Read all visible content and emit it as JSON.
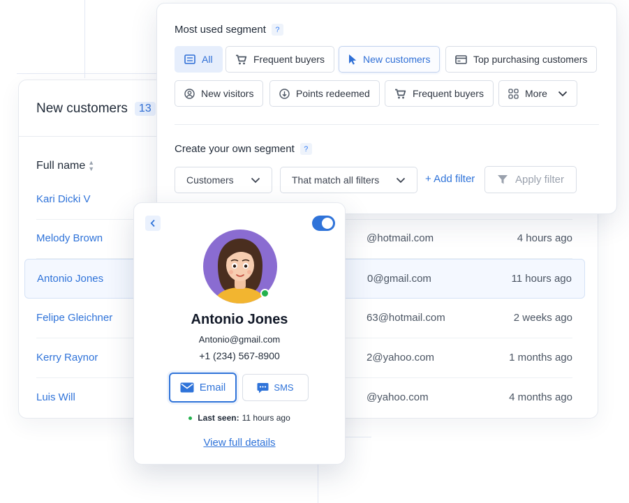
{
  "colors": {
    "accent": "#2f73d9",
    "online": "#22b14c",
    "chip_active_bg": "#e6eefc",
    "avatar_bg": "#8a6cd1"
  },
  "customers_table": {
    "title": "New customers",
    "count": "13",
    "column_full_name": "Full name",
    "rows": [
      {
        "name": "Kari Dicki V",
        "email": "",
        "last_seen": ""
      },
      {
        "name": "Melody Brown",
        "email": "@hotmail.com",
        "last_seen": "4 hours ago"
      },
      {
        "name": "Antonio Jones",
        "email": "0@gmail.com",
        "last_seen": "11 hours ago",
        "selected": true
      },
      {
        "name": "Felipe Gleichner",
        "email": "63@hotmail.com",
        "last_seen": "2 weeks ago"
      },
      {
        "name": "Kerry Raynor",
        "email": "2@yahoo.com",
        "last_seen": "1 months ago"
      },
      {
        "name": "Luis Will",
        "email": "@yahoo.com",
        "last_seen": "4 months ago"
      }
    ]
  },
  "segment_panel": {
    "most_used_title": "Most used segment",
    "help_mark": "?",
    "chips": [
      {
        "label": "All",
        "icon": "list-icon",
        "state": "active"
      },
      {
        "label": "Frequent buyers",
        "icon": "cart-icon"
      },
      {
        "label": "New customers",
        "icon": "cursor-icon",
        "state": "focus"
      },
      {
        "label": "Top purchasing customers",
        "icon": "card-icon"
      },
      {
        "label": "New visitors",
        "icon": "user-circle-icon"
      },
      {
        "label": "Points redeemed",
        "icon": "arrow-down-circle-icon"
      },
      {
        "label": "Frequent buyers",
        "icon": "cart-icon"
      },
      {
        "label": "More",
        "icon": "grid-icon"
      }
    ],
    "create_title": "Create your own segment",
    "select_customers": "Customers",
    "select_match": "That match all filters",
    "add_filter": "+ Add filter",
    "apply_filter": "Apply filter"
  },
  "profile": {
    "name": "Antonio Jones",
    "email": "Antonio@gmail.com",
    "phone": "+1 (234) 567-8900",
    "email_button": "Email",
    "sms_button": "SMS",
    "last_seen_label": "Last seen:",
    "last_seen_value": "11 hours ago",
    "view_details": "View full details",
    "notifications_enabled": true,
    "online": true
  }
}
